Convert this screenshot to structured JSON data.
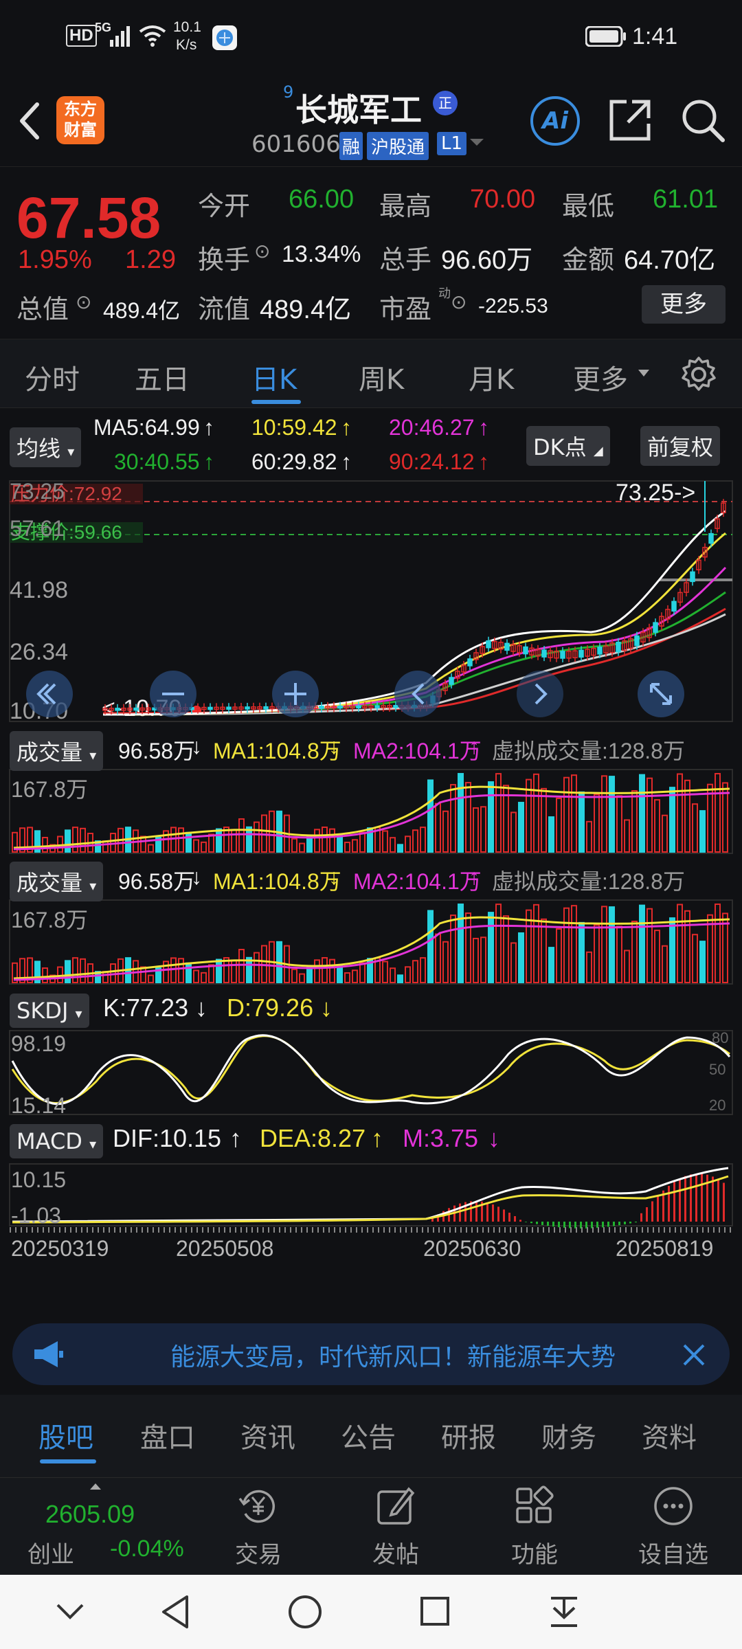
{
  "status_bar": {
    "network": "HD",
    "signal": "5G",
    "speed_value": "10.1",
    "speed_unit": "K/s",
    "time": "1:41"
  },
  "header": {
    "logo_line1": "东方",
    "logo_line2": "财富",
    "superscript": "9",
    "stock_name": "长城军工",
    "stock_badge": "正",
    "stock_code": "601606",
    "tag_margin": "融",
    "tag_connect": "沪股通",
    "tag_level": "L1",
    "ai_label": "Ai"
  },
  "quote": {
    "price": "67.58",
    "change_pct": "1.95%",
    "change_amt": "1.29",
    "open_label": "今开",
    "open": "66.00",
    "high_label": "最高",
    "high": "70.00",
    "low_label": "最低",
    "low": "61.01",
    "turnover_label": "换手",
    "turnover": "13.34%",
    "volume_label": "总手",
    "volume": "96.60万",
    "amount_label": "金额",
    "amount": "64.70亿",
    "mktcap_label": "总值",
    "mktcap": "489.4亿",
    "float_label": "流值",
    "float_cap": "489.4亿",
    "pe_label": "市盈",
    "pe_sup": "动",
    "pe": "-225.53",
    "more_label": "更多"
  },
  "tabs": [
    "分时",
    "五日",
    "日K",
    "周K",
    "月K",
    "更多"
  ],
  "active_tab": "日K",
  "kline": {
    "indicator": "均线",
    "ma5": "MA5:64.99",
    "ma10": "10:59.42",
    "ma20": "20:46.27",
    "ma30": "30:40.55",
    "ma60": "60:29.82",
    "ma90": "90:24.12",
    "dk_label": "DK点",
    "adjust_label": "前复权",
    "axis": [
      "73.25",
      "57.61",
      "41.98",
      "26.34",
      "10.70"
    ],
    "target_label": "压力价:72.92",
    "support_label": "支撑价:59.66",
    "max_marker": "73.25->",
    "min_marker": "<-10.70"
  },
  "volume1": {
    "label": "成交量",
    "vol": "96.58万",
    "ma1": "MA1:104.8万",
    "ma2": "MA2:104.1万",
    "virtual": "虚拟成交量:128.8万",
    "axis_max": "167.8万"
  },
  "volume2": {
    "label": "成交量",
    "vol": "96.58万",
    "ma1": "MA1:104.8万",
    "ma2": "MA2:104.1万",
    "virtual": "虚拟成交量:128.8万",
    "axis_max": "167.8万"
  },
  "skdj": {
    "label": "SKDJ",
    "k": "K:77.23",
    "d": "D:79.26",
    "axis_top": "98.19",
    "axis_bottom": "15.14",
    "level_80": "80",
    "level_50": "50",
    "level_20": "20"
  },
  "macd": {
    "label": "MACD",
    "dif": "DIF:10.15",
    "dea": "DEA:8.27",
    "m": "M:3.75",
    "axis_top": "10.15",
    "axis_bottom": "-1.03"
  },
  "dates": [
    "20250319",
    "20250508",
    "20250630",
    "20250819"
  ],
  "banner": {
    "text": "能源大变局，时代新风口！新能源车大势"
  },
  "bottom_tabs": [
    "股吧",
    "盘口",
    "资讯",
    "公告",
    "研报",
    "财务",
    "资料"
  ],
  "toolbar": {
    "index_value": "2605.09",
    "index_name": "创业",
    "index_change": "-0.04%",
    "trade": "交易",
    "post": "发帖",
    "functions": "功能",
    "watchlist": "设自选"
  },
  "colors": {
    "up": "#e02a2a",
    "down": "#21b12f",
    "accent": "#3a8dde",
    "ma5": "#ffffff",
    "ma10": "#f1e33b",
    "ma20": "#e334d8",
    "ma30": "#21b12f",
    "ma60": "#d0d0d0",
    "ma90": "#e02a2a"
  }
}
